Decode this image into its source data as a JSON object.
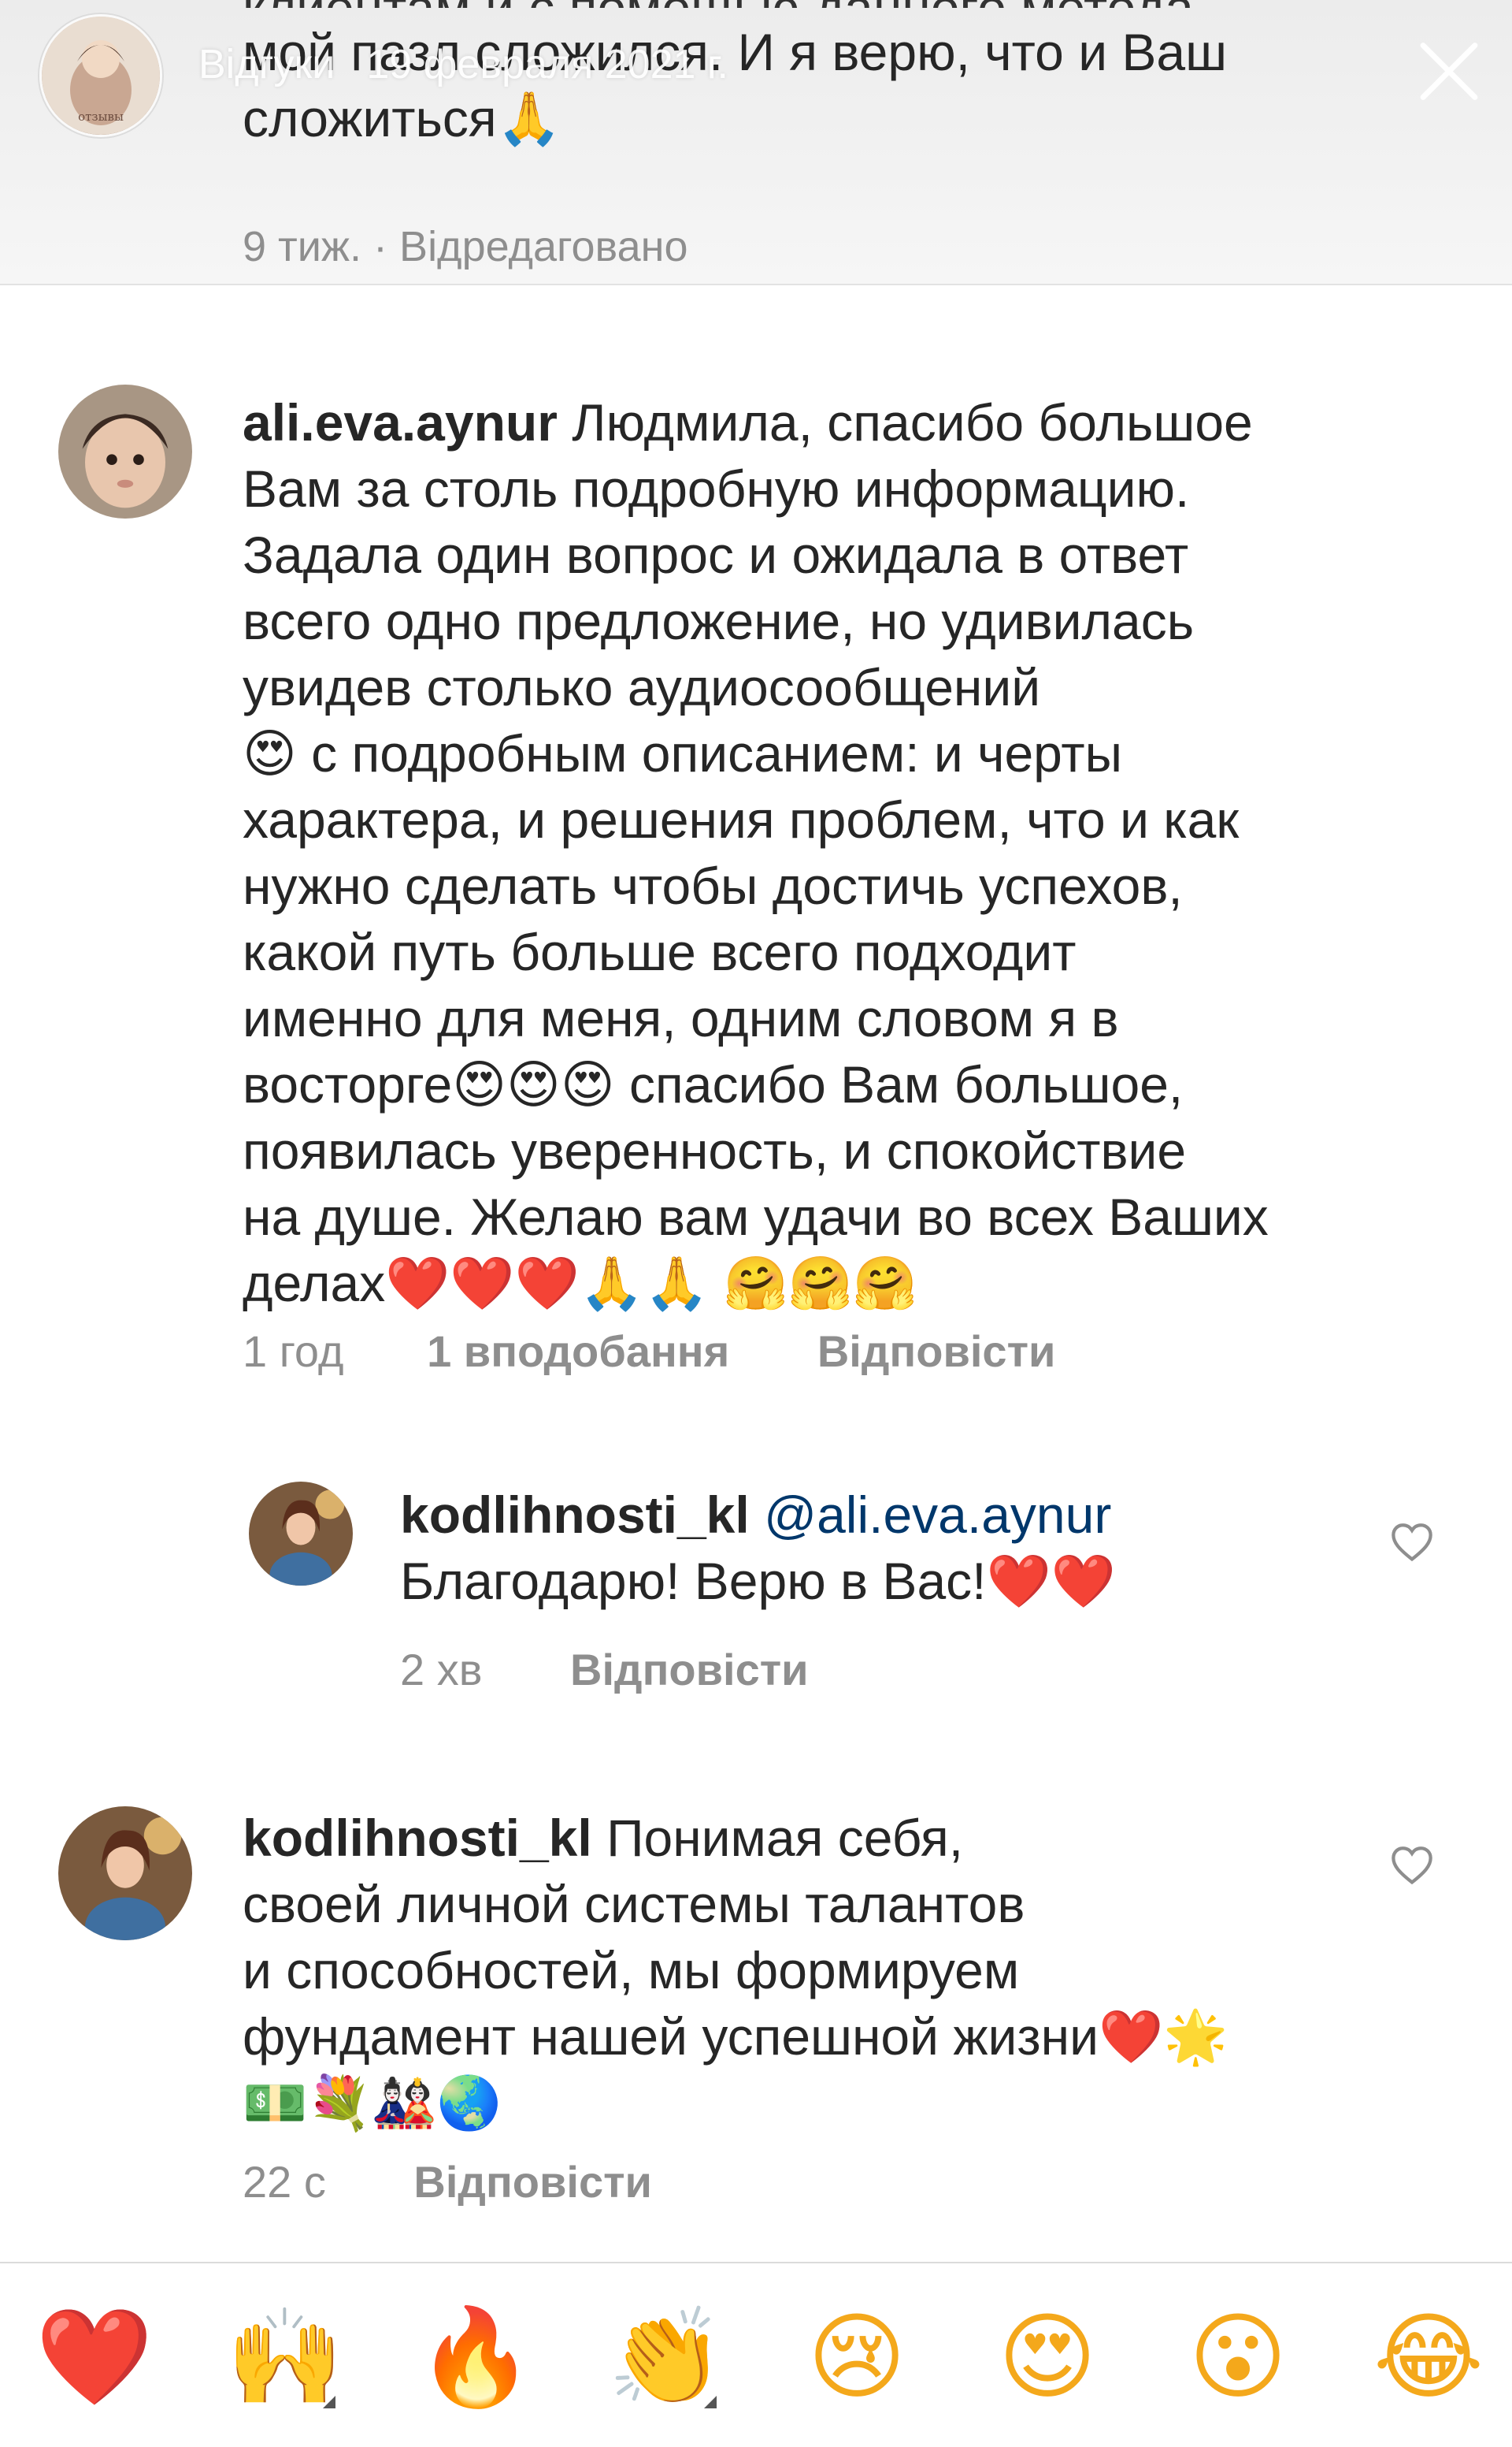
{
  "story": {
    "title": "Відгуки",
    "date": "19 февраля 2021 г.",
    "previous_comment": {
      "clipped_line": "клиентам и с помощью данного метода,",
      "lines": [
        "мой пазл сложился. И я верю, что и Ваш",
        "сложиться🙏"
      ],
      "meta": "9 тиж. · Відредаговано"
    }
  },
  "comments": [
    {
      "username": "ali.eva.aynur",
      "first_line": "Людмила, спасибо большое",
      "lines": [
        "Вам за столь подробную информацию.",
        "Задала один вопрос и ожидала в ответ",
        "всего одно предложение, но удивилась",
        "увидев столько аудиосообщений",
        "😍 с подробным описанием:  и черты",
        "характера, и решения проблем, что и как",
        "нужно сделать чтобы достичь успехов,",
        "какой путь больше всего  подходит",
        "именно для меня, одним словом я в",
        "восторге😍😍😍 спасибо Вам большое,",
        "появилась уверенность, и спокойствие",
        "на душе. Желаю вам удачи во всех Ваших",
        "делах❤️❤️❤️🙏🙏 🤗🤗🤗"
      ],
      "time": "1 год",
      "likes": "1 вподобання",
      "reply": "Відповісти"
    },
    {
      "username": "kodlihnosti_kl",
      "mention": "@ali.eva.aynur",
      "lines": [
        "Благодарю! Верю в Вас!❤️❤️"
      ],
      "time": "2 хв",
      "reply": "Відповісти"
    },
    {
      "username": "kodlihnosti_kl",
      "first_line": "Понимая себя,",
      "lines": [
        "своей личной системы талантов",
        "и способностей, мы формируем",
        "фундамент нашей успешной жизни❤️🌟",
        "💵💐🎎🌏"
      ],
      "time": "22 с",
      "reply": "Відповісти"
    }
  ],
  "emoji_bar": [
    {
      "glyph": "❤️",
      "icon": "red-heart-icon",
      "color": "#e0162b"
    },
    {
      "glyph": "🙌",
      "icon": "raising-hands-icon",
      "color": "#f4a81b"
    },
    {
      "glyph": "🔥",
      "icon": "fire-icon",
      "color": "#f2541b"
    },
    {
      "glyph": "👏",
      "icon": "clapping-hands-icon",
      "color": "#f4a81b"
    },
    {
      "glyph": "😢",
      "icon": "crying-face-icon",
      "color": "#f4a81b"
    },
    {
      "glyph": "😍",
      "icon": "heart-eyes-icon",
      "color": "#f4a81b"
    },
    {
      "glyph": "😮",
      "icon": "surprised-face-icon",
      "color": "#f4a81b"
    },
    {
      "glyph": "😂",
      "icon": "tears-of-joy-icon",
      "color": "#f4a81b"
    }
  ],
  "colors": {
    "text": "#262626",
    "secondary": "#8e8e8e",
    "mention": "#00376b",
    "heart": "#e0162b"
  }
}
